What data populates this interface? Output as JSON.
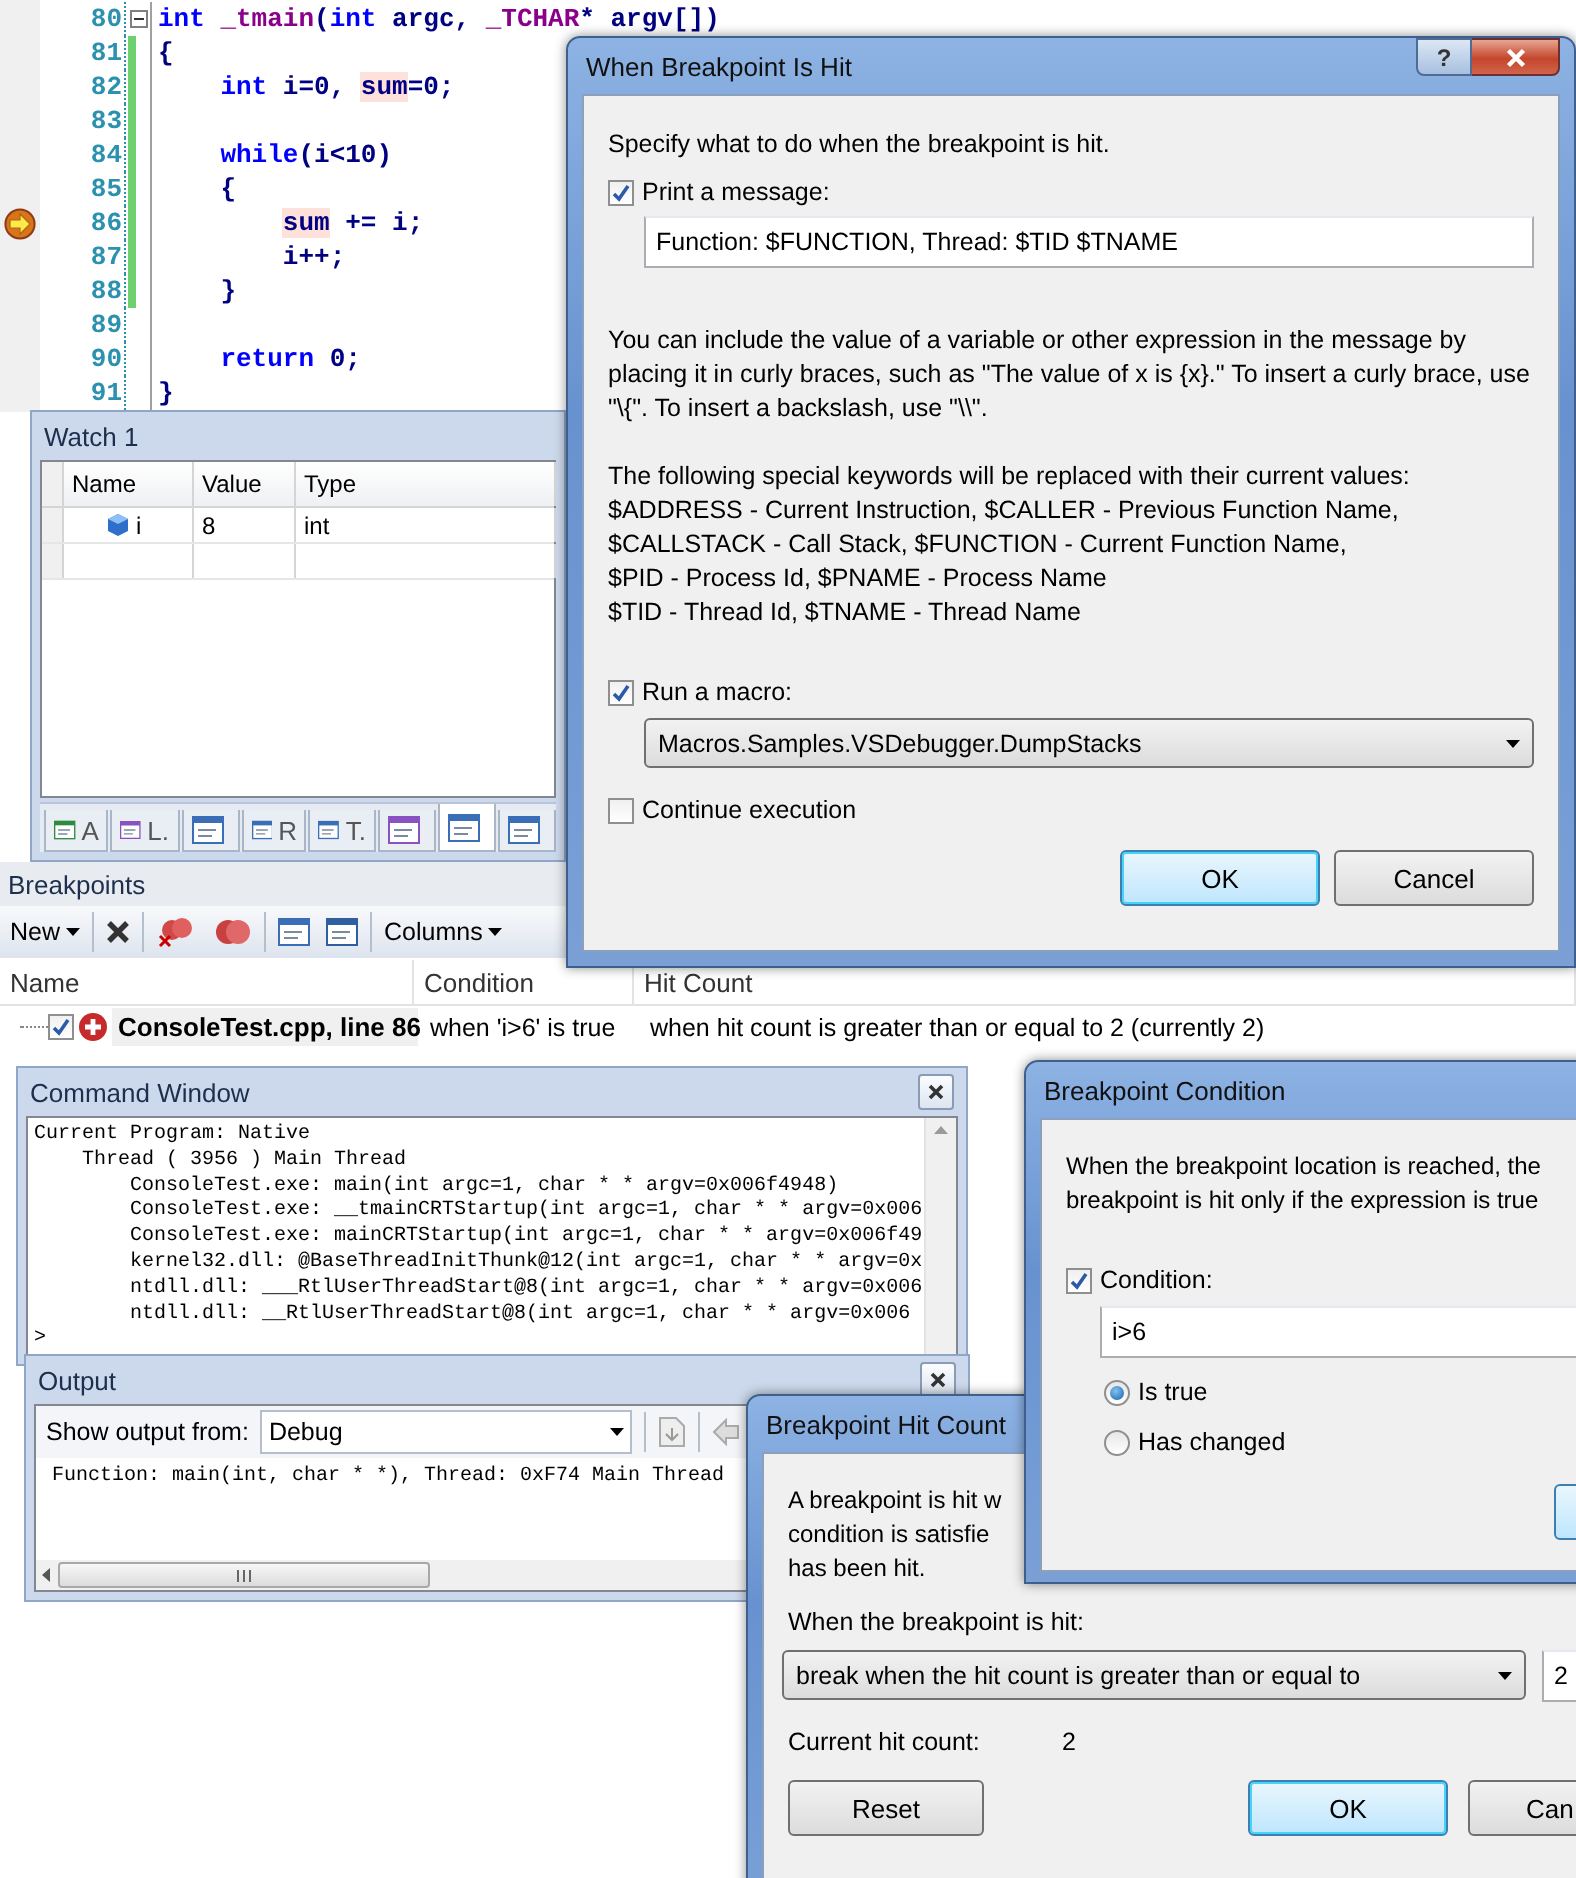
{
  "editor": {
    "lines": [
      {
        "number": "80",
        "fold": true,
        "changed": false,
        "current": false,
        "tokens": [
          {
            "text": "int",
            "kind": "keyword"
          },
          {
            "text": " _tmain",
            "kind": "macro"
          },
          {
            "text": "(",
            "kind": "identifier"
          },
          {
            "text": "int",
            "kind": "keyword"
          },
          {
            "text": " argc, ",
            "kind": "identifier"
          },
          {
            "text": "_TCHAR",
            "kind": "macro"
          },
          {
            "text": "* argv[])",
            "kind": "identifier"
          }
        ]
      },
      {
        "number": "81",
        "fold": false,
        "changed": true,
        "current": false,
        "tokens": [
          {
            "text": "{",
            "kind": "identifier"
          }
        ]
      },
      {
        "number": "82",
        "fold": false,
        "changed": true,
        "current": false,
        "tokens": [
          {
            "text": "    int",
            "kind": "keyword"
          },
          {
            "text": " i=0, ",
            "kind": "identifier"
          },
          {
            "text": "sum",
            "kind": "highlight"
          },
          {
            "text": "=0;",
            "kind": "identifier"
          }
        ]
      },
      {
        "number": "83",
        "fold": false,
        "changed": true,
        "current": false
      },
      {
        "number": "84",
        "fold": false,
        "changed": true,
        "current": false,
        "tokens": [
          {
            "text": "    while",
            "kind": "keyword"
          },
          {
            "text": "(i<10)",
            "kind": "identifier"
          }
        ]
      },
      {
        "number": "85",
        "fold": false,
        "changed": true,
        "current": false,
        "tokens": [
          {
            "text": "    {",
            "kind": "identifier"
          }
        ]
      },
      {
        "number": "86",
        "fold": false,
        "changed": true,
        "current": true,
        "tokens": [
          {
            "text": "        sum",
            "kind": "highlight"
          },
          {
            "text": " += i;",
            "kind": "identifier"
          }
        ]
      },
      {
        "number": "87",
        "fold": false,
        "changed": true,
        "current": false,
        "tokens": [
          {
            "text": "        i++;",
            "kind": "identifier"
          }
        ]
      },
      {
        "number": "88",
        "fold": false,
        "changed": true,
        "current": false,
        "tokens": [
          {
            "text": "    }",
            "kind": "identifier"
          }
        ]
      },
      {
        "number": "89",
        "fold": false,
        "changed": false,
        "current": false
      },
      {
        "number": "90",
        "fold": false,
        "changed": false,
        "current": false,
        "tokens": [
          {
            "text": "    return",
            "kind": "keyword"
          },
          {
            "text": " 0;",
            "kind": "identifier"
          }
        ]
      },
      {
        "number": "91",
        "fold": false,
        "changed": false,
        "current": false,
        "tokens": [
          {
            "text": "}",
            "kind": "identifier"
          }
        ]
      }
    ]
  },
  "watch": {
    "title": "Watch 1",
    "columns": [
      "Name",
      "Value",
      "Type"
    ],
    "rows": [
      {
        "name": "i",
        "value": "8",
        "type": "int"
      }
    ],
    "tabs": [
      {
        "label": "A",
        "selected": false
      },
      {
        "label": "L.",
        "selected": false
      },
      {
        "selected": false
      },
      {
        "label": "R",
        "selected": false
      },
      {
        "label": "T.",
        "selected": false
      },
      {
        "selected": false
      },
      {
        "selected": true
      },
      {
        "selected": false
      }
    ]
  },
  "breakpoints": {
    "title": "Breakpoints",
    "new_button": "New",
    "columns_button": "Columns",
    "columns": [
      "Name",
      "Condition",
      "Hit Count"
    ],
    "rows": [
      {
        "checked": true,
        "name": "ConsoleTest.cpp, line 86",
        "condition": "when 'i>6' is true",
        "hit_count": "when hit count is greater than or equal to 2 (currently 2)"
      }
    ]
  },
  "command_window": {
    "title": "Command Window",
    "lines": [
      "Current Program: Native",
      "    Thread ( 3956 ) Main Thread",
      "        ConsoleTest.exe: main(int argc=1, char * * argv=0x006f4948)",
      "        ConsoleTest.exe: __tmainCRTStartup(int argc=1, char * * argv=0x006",
      "        ConsoleTest.exe: mainCRTStartup(int argc=1, char * * argv=0x006f49",
      "        kernel32.dll: @BaseThreadInitThunk@12(int argc=1, char * * argv=0x",
      "        ntdll.dll: ___RtlUserThreadStart@8(int argc=1, char * * argv=0x006",
      "        ntdll.dll: __RtlUserThreadStart@8(int argc=1, char * * argv=0x006"
    ],
    "prompt": ">"
  },
  "output": {
    "title": "Output",
    "source_label": "Show output from:",
    "source": "Debug",
    "text": "Function: main(int, char * *), Thread: 0xF74 Main Thread"
  },
  "hit_count_dialog": {
    "title": "Breakpoint Hit Count",
    "description": [
      "A breakpoint is hit w",
      "condition is satisfie",
      "has been hit."
    ],
    "when_label": "When the breakpoint is hit:",
    "mode": "break when the hit count is greater than or equal to",
    "count": "2",
    "current_label": "Current hit count:",
    "current": "2",
    "buttons": [
      {
        "label": "Reset",
        "default": false
      },
      {
        "label": "OK",
        "default": true
      },
      {
        "label": "Can",
        "default": false
      }
    ]
  },
  "condition_dialog": {
    "title": "Breakpoint Condition",
    "description": [
      "When the breakpoint location is reached, the",
      "breakpoint is hit only if the expression is true"
    ],
    "condition": {
      "label": "Condition:",
      "checked": true,
      "value": "i>6"
    },
    "options": [
      {
        "label": "Is true",
        "selected": true
      },
      {
        "label": "Has changed",
        "selected": false
      }
    ]
  },
  "when_hit_dialog": {
    "title": "When Breakpoint Is Hit",
    "help": "?",
    "intro": "Specify what to do when the breakpoint is hit.",
    "print": {
      "label": "Print a message:",
      "checked": true,
      "value": "Function: $FUNCTION, Thread: $TID $TNAME"
    },
    "help_text": "You can include the value of a variable or other expression in the message by placing it in curly braces, such as \"The value of x is {x}.\" To insert a curly brace, use \"\\{\". To insert a backslash, use \"\\\\\".",
    "keywords_intro": "The following special keywords will be replaced with their current values:",
    "keywords": [
      "$ADDRESS - Current Instruction, $CALLER - Previous Function Name,",
      "$CALLSTACK - Call Stack, $FUNCTION - Current Function Name,",
      "$PID - Process Id, $PNAME - Process Name",
      "$TID - Thread Id, $TNAME - Thread Name"
    ],
    "macro": {
      "label": "Run a macro:",
      "checked": true,
      "value": "Macros.Samples.VSDebugger.DumpStacks"
    },
    "continue": {
      "label": "Continue execution",
      "checked": false
    },
    "buttons": [
      {
        "label": "OK",
        "default": true
      },
      {
        "label": "Cancel",
        "default": false
      }
    ]
  }
}
